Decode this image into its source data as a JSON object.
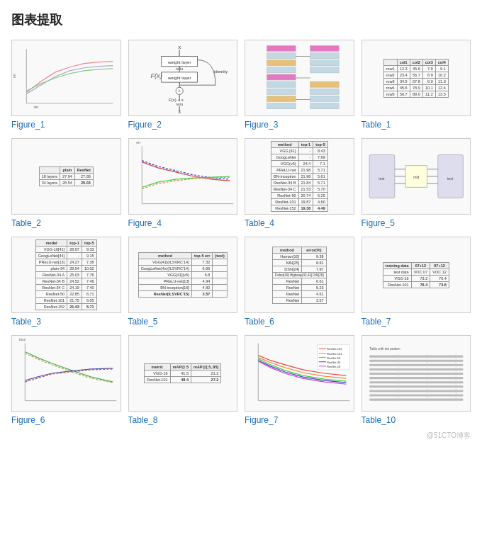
{
  "page": {
    "title": "图表提取"
  },
  "items": [
    {
      "id": "fig1",
      "label": "Figure_1",
      "type": "figure"
    },
    {
      "id": "fig2",
      "label": "Figure_2",
      "type": "figure"
    },
    {
      "id": "fig3",
      "label": "Figure_3",
      "type": "figure"
    },
    {
      "id": "tbl1",
      "label": "Table_1",
      "type": "table"
    },
    {
      "id": "tbl2",
      "label": "Table_2",
      "type": "table"
    },
    {
      "id": "fig4",
      "label": "Figure_4",
      "type": "figure"
    },
    {
      "id": "tbl4",
      "label": "Table_4",
      "type": "table"
    },
    {
      "id": "fig5",
      "label": "Figure_5",
      "type": "figure"
    },
    {
      "id": "tbl3",
      "label": "Table_3",
      "type": "table"
    },
    {
      "id": "tbl5",
      "label": "Table_5",
      "type": "table"
    },
    {
      "id": "tbl6",
      "label": "Table_6",
      "type": "table"
    },
    {
      "id": "tbl7",
      "label": "Table_7",
      "type": "table"
    },
    {
      "id": "fig6",
      "label": "Figure_6",
      "type": "figure"
    },
    {
      "id": "tbl8",
      "label": "Table_8",
      "type": "table"
    },
    {
      "id": "fig7",
      "label": "Figure_7",
      "type": "figure"
    },
    {
      "id": "tbl10",
      "label": "Table_10",
      "type": "table"
    }
  ],
  "watermark": "@51CTO博客"
}
